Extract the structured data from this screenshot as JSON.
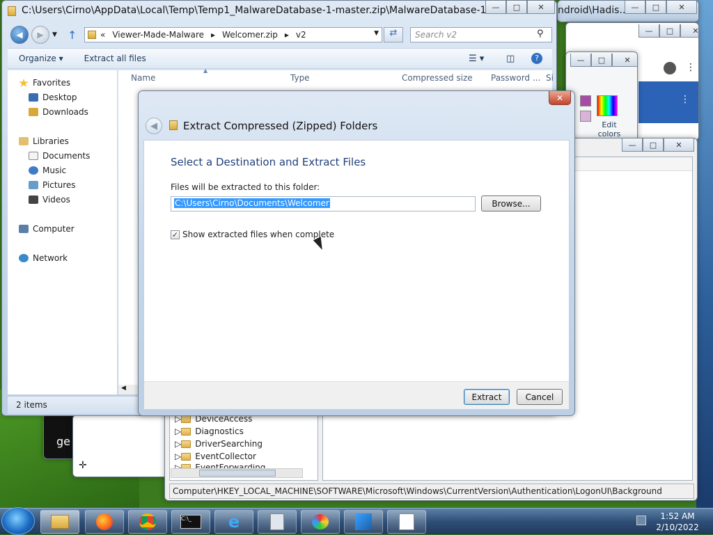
{
  "explorer": {
    "title": "C:\\Users\\Cirno\\AppData\\Local\\Temp\\Temp1_MalwareDatabase-1-master.zip\\MalwareDatabase-1-m...",
    "breadcrumb": [
      "«",
      "Viewer-Made-Malware",
      "▸",
      "Welcomer.zip",
      "▸",
      "v2"
    ],
    "search_placeholder": "Search v2",
    "toolbar": {
      "organize": "Organize ▾",
      "extract_all": "Extract all files"
    },
    "nav": {
      "favorites": "Favorites",
      "desktop": "Desktop",
      "downloads": "Downloads",
      "libraries": "Libraries",
      "documents": "Documents",
      "music": "Music",
      "pictures": "Pictures",
      "videos": "Videos",
      "computer": "Computer",
      "network": "Network"
    },
    "columns": {
      "name": "Name",
      "type": "Type",
      "compressed": "Compressed size",
      "password": "Password ...",
      "size": "Si"
    },
    "status": "2 items"
  },
  "background_window_title": "ndroid\\Hadis...",
  "paint": {
    "edit_colors": "Edit colors"
  },
  "cmd": {
    "text": "ge"
  },
  "regedit": {
    "tree": [
      "DeviceAccess",
      "Diagnostics",
      "DriverSearching",
      "EventCollector",
      "EventForwarding"
    ],
    "status": "Computer\\HKEY_LOCAL_MACHINE\\SOFTWARE\\Microsoft\\Windows\\CurrentVersion\\Authentication\\LogonUI\\Background"
  },
  "dialog": {
    "title": "Extract Compressed (Zipped) Folders",
    "close": "✕",
    "heading": "Select a Destination and Extract Files",
    "folder_label": "Files will be extracted to this folder:",
    "path": "C:\\Users\\Cirno\\Documents\\Welcomer",
    "browse": "Browse...",
    "show_files_label": "Show extracted files when complete",
    "show_files_checked": "✓",
    "extract": "Extract",
    "cancel": "Cancel"
  },
  "taskbar": {
    "time": "1:52 AM",
    "date": "2/10/2022"
  }
}
